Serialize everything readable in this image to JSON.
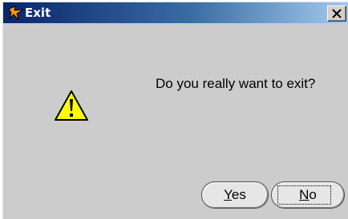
{
  "dialog": {
    "title": "Exit",
    "message": "Do you really want to exit?",
    "icon": "warning-icon",
    "close_icon": "close-icon",
    "buttons": {
      "yes": {
        "first": "Y",
        "rest": "es"
      },
      "no": {
        "first": "N",
        "rest": "o"
      }
    }
  },
  "colors": {
    "titlebar_start": "#0a246a",
    "titlebar_end": "#a6caf0",
    "dialog_bg": "#cccccc",
    "warning_yellow": "#ffff00"
  }
}
